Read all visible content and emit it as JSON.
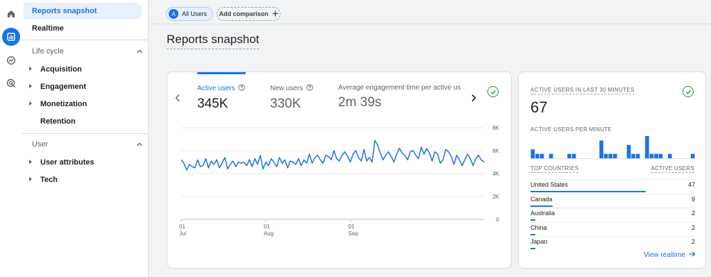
{
  "colors": {
    "accent": "#1a73e8",
    "success": "#1e8e3e",
    "muted": "#5f6368"
  },
  "rail": {
    "icons": [
      "home-icon",
      "reports-icon",
      "explore-icon",
      "advertising-icon"
    ]
  },
  "sidebar": {
    "top_items": [
      {
        "label": "Reports snapshot",
        "selected": true
      },
      {
        "label": "Realtime",
        "selected": false
      }
    ],
    "sections": [
      {
        "title": "Life cycle",
        "items": [
          {
            "label": "Acquisition",
            "expandable": true
          },
          {
            "label": "Engagement",
            "expandable": true
          },
          {
            "label": "Monetization",
            "expandable": true
          },
          {
            "label": "Retention",
            "expandable": false
          }
        ]
      },
      {
        "title": "User",
        "items": [
          {
            "label": "User attributes",
            "expandable": true
          },
          {
            "label": "Tech",
            "expandable": true
          }
        ]
      }
    ]
  },
  "header": {
    "comparison_chip": {
      "avatar_letter": "A",
      "label": "All Users"
    },
    "add_comparison_label": "Add comparison",
    "page_title": "Reports snapshot"
  },
  "metrics": [
    {
      "label": "Active users",
      "value": "345K",
      "active": true
    },
    {
      "label": "New users",
      "value": "330K",
      "active": false
    },
    {
      "label": "Average engagement time per active us",
      "value": "2m 39s",
      "active": false
    }
  ],
  "chart_data": {
    "type": "line",
    "title": "",
    "xlabel": "",
    "ylabel": "",
    "ylim": [
      0,
      8000
    ],
    "y_ticks": [
      "8K",
      "6K",
      "4K",
      "2K",
      "0"
    ],
    "x_ticks": [
      {
        "day": "01",
        "month": "Jul"
      },
      {
        "day": "01",
        "month": "Aug"
      },
      {
        "day": "01",
        "month": "Sep"
      }
    ],
    "grid": true,
    "series": [
      {
        "values": [
          5200,
          4900,
          4300,
          4800,
          4600,
          4500,
          5200,
          4600,
          4700,
          5300,
          4500,
          5100,
          4800,
          5200,
          4500,
          4900,
          5400,
          4400,
          4800,
          5100,
          4600,
          5000,
          4900,
          5000,
          4700,
          5200,
          4600,
          5300,
          4800,
          5600,
          4400,
          5000,
          4700,
          5300,
          5000,
          4600,
          5400,
          4900,
          5200,
          4500,
          5100,
          5000,
          4800,
          5300,
          4700,
          5200,
          4900,
          5700,
          4900,
          5400,
          5600,
          5200,
          4900,
          5600,
          5500,
          5200,
          6000,
          5300,
          5100,
          5600,
          5900,
          5500,
          5000,
          5700,
          6000,
          5400,
          5100,
          6100,
          5100,
          5400,
          5000,
          6900,
          6500,
          5800,
          5200,
          5600,
          5900,
          5500,
          5000,
          5700,
          6200,
          5800,
          5600,
          5200,
          5900,
          6000,
          5600,
          5300,
          6300,
          5700,
          6200,
          5800,
          5100,
          5900,
          5700,
          4900,
          5200,
          6100,
          5900,
          5500,
          4800,
          5600,
          5200,
          4700,
          5200,
          5700,
          5300,
          4700,
          5300,
          5600,
          5200,
          5000
        ]
      }
    ]
  },
  "realtime": {
    "title": "ACTIVE USERS IN LAST 30 MINUTES",
    "value": "67",
    "per_minute_label": "ACTIVE USERS PER MINUTE",
    "per_minute": [
      2,
      1,
      1,
      0,
      1,
      0,
      0,
      0,
      1,
      1,
      0,
      0,
      0,
      0,
      0,
      4,
      1,
      1,
      1,
      0,
      0,
      3,
      1,
      1,
      0,
      5,
      1,
      1,
      1,
      0,
      1,
      0,
      0,
      0,
      0,
      1
    ],
    "countries_header": "TOP COUNTRIES",
    "users_header": "ACTIVE USERS",
    "countries": [
      {
        "name": "United States",
        "users": "47",
        "fraction": 1.0
      },
      {
        "name": "Canada",
        "users": "9",
        "fraction": 0.19
      },
      {
        "name": "Australia",
        "users": "2",
        "fraction": 0.04
      },
      {
        "name": "China",
        "users": "2",
        "fraction": 0.04
      },
      {
        "name": "Japan",
        "users": "2",
        "fraction": 0.04
      }
    ],
    "view_link": "View realtime"
  }
}
